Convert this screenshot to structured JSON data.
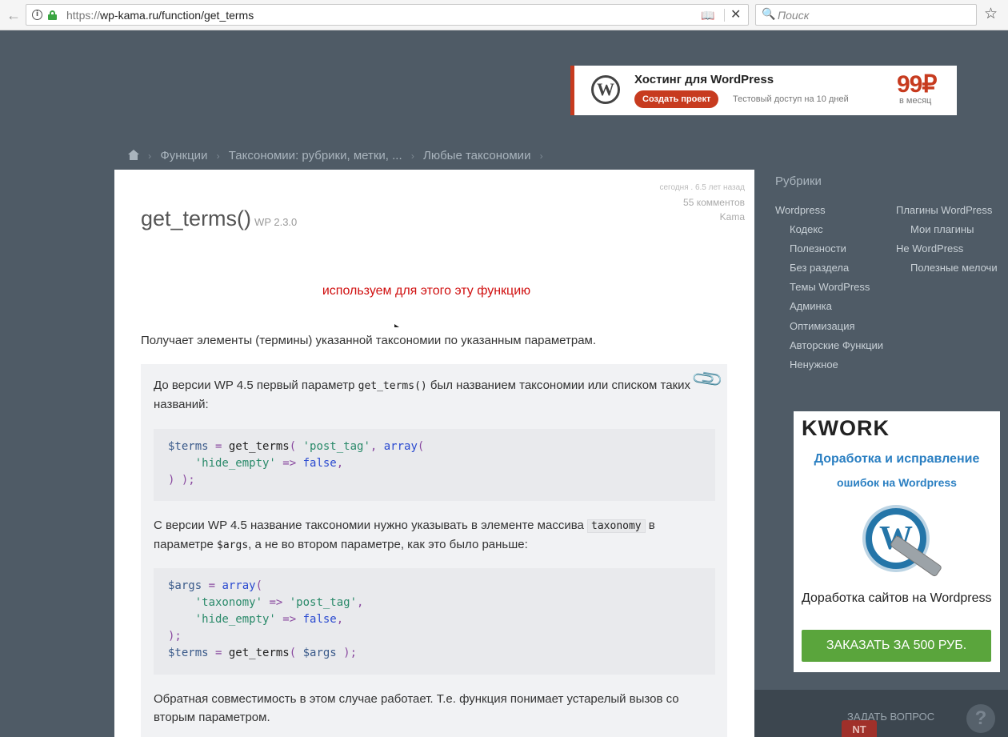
{
  "browser": {
    "url_scheme": "https://",
    "url_host_path": "wp-kama.ru/function/get_terms",
    "search_placeholder": "Поиск",
    "info_glyph": "i",
    "back_glyph": "←",
    "close_glyph": "✕",
    "star_glyph": "☆",
    "search_glyph": "🔍",
    "reader_glyph": "📖"
  },
  "ad_top": {
    "logo": "W",
    "title": "Хостинг для WordPress",
    "button": "Создать проект",
    "note": "Тестовый доступ на 10 дней",
    "price": "99₽",
    "per": "в месяц",
    "accent": "#c73b1f"
  },
  "breadcrumb": {
    "items": [
      "Функции",
      "Таксономии: рубрики, метки, ...",
      "Любые таксономии"
    ],
    "sep": "›"
  },
  "article": {
    "meta_date": "сегодня . 6.5 лет назад",
    "meta_comments": "55 комментов",
    "meta_author": "Kama",
    "title": "get_terms()",
    "version": "WP 2.3.0",
    "annotation": "используем для этого эту функцию",
    "lead": "Получает элементы (термины) указанной таксономии по указанным параметрам.",
    "note_p1_before": "До версии WP 4.5 первый параметр ",
    "note_p1_code": "get_terms()",
    "note_p1_after": " был названием таксономии или списком таких названий:",
    "code1": {
      "l1_var": "$terms",
      "l1_op": " = ",
      "l1_fn": "get_terms",
      "l1_open": "( ",
      "l1_str": "'post_tag'",
      "l1_comma": ", ",
      "l1_kw": "array",
      "l1_paren": "(",
      "l2_indent": "    ",
      "l2_str": "'hide_empty'",
      "l2_op": " => ",
      "l2_kw": "false",
      "l2_comma": ",",
      "l3": ") );"
    },
    "note_p2_before": "С версии WP 4.5 название таксономии нужно указывать в элементе массива ",
    "note_p2_code": "taxonomy",
    "note_p2_mid": " в параметре ",
    "note_p2_code2": "$args",
    "note_p2_after": ", а не во втором параметре, как это было раньше:",
    "code2": {
      "l1_var": "$args",
      "l1_op": " = ",
      "l1_kw": "array",
      "l1_paren": "(",
      "l2_indent": "    ",
      "l2_str1": "'taxonomy'",
      "l2_op": " => ",
      "l2_str2": "'post_tag'",
      "l2_comma": ",",
      "l3_indent": "    ",
      "l3_str": "'hide_empty'",
      "l3_op": " => ",
      "l3_kw": "false",
      "l3_comma": ",",
      "l4": ");",
      "l5_var": "$terms",
      "l5_op": " = ",
      "l5_fn": "get_terms",
      "l5_open": "( ",
      "l5_arg": "$args",
      "l5_close": " );"
    },
    "note_p3": "Обратная совместимость в этом случае работает. Т.е. функция понимает устарелый вызов со вторым параметром."
  },
  "sidebar": {
    "rubrics_title": "Рубрики",
    "col1": [
      "Wordpress",
      "Кодекс",
      "Полезности",
      "Без раздела",
      "Темы WordPress",
      "Админка",
      "Оптимизация",
      "Авторские Функции",
      "Ненужное"
    ],
    "col2": [
      "Плагины WordPress",
      "Мои плагины",
      "Не WordPress",
      "Полезные мелочи"
    ]
  },
  "kwork": {
    "logo": "KWORK",
    "h1": "Доработка и исправление",
    "h2": "ошибок на Wordpress",
    "wp_glyph": "W",
    "text": "Доработка сайтов на Wordpress",
    "button": "ЗАКАЗАТЬ ЗА 500 РУБ."
  },
  "footer_bar": {
    "ask": "ЗАДАТЬ ВОПРОС",
    "help": "?",
    "badge": "NT"
  }
}
